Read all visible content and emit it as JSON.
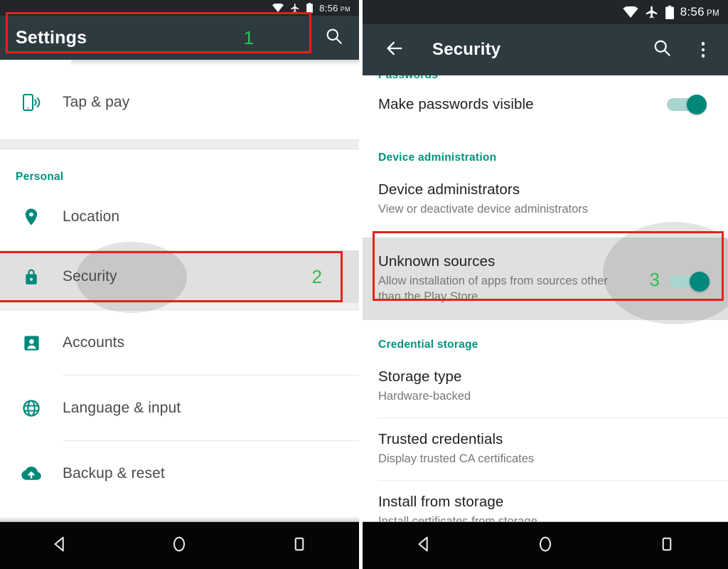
{
  "left_panel": {
    "statusbar": {
      "time": "8:56",
      "ampm": "PM",
      "icons": [
        "wifi-icon",
        "airplane-icon",
        "battery-icon"
      ]
    },
    "appbar": {
      "title": "Settings",
      "search_icon": "search-icon"
    },
    "scroll_hint": "top-shadow",
    "items": [
      {
        "label": "Tap & pay",
        "icon": "nfc-phone-icon",
        "marker": ""
      }
    ],
    "section": {
      "label": "Personal"
    },
    "personal_items": [
      {
        "label": "Location",
        "icon": "location-pin-icon",
        "marker": ""
      },
      {
        "label": "Security",
        "icon": "lock-icon",
        "marker": "2",
        "highlighted": true
      },
      {
        "label": "Accounts",
        "icon": "account-icon",
        "marker": ""
      },
      {
        "label": "Language & input",
        "icon": "globe-icon",
        "marker": ""
      },
      {
        "label": "Backup & reset",
        "icon": "cloud-upload-icon",
        "marker": ""
      }
    ],
    "annotations": [
      {
        "label": "1",
        "target": "appbar-title"
      },
      {
        "label": "2",
        "target": "security-row"
      }
    ],
    "navbar": {
      "back": "back-triangle-icon",
      "home": "home-circle-icon",
      "recents": "recents-square-icon"
    }
  },
  "right_panel": {
    "statusbar": {
      "time": "8:56",
      "ampm": "PM",
      "icons": [
        "wifi-icon",
        "airplane-icon",
        "battery-icon"
      ]
    },
    "appbar": {
      "title": "Security",
      "back_icon": "back-arrow-icon",
      "search_icon": "search-icon",
      "overflow_icon": "overflow-menu-icon"
    },
    "sections": [
      {
        "header": "Passwords",
        "rows": [
          {
            "title": "Make passwords visible",
            "subtitle": "",
            "toggle": true,
            "toggle_on": true,
            "marker": ""
          }
        ]
      },
      {
        "header": "Device administration",
        "rows": [
          {
            "title": "Device administrators",
            "subtitle": "View or deactivate device administrators",
            "toggle": false,
            "marker": ""
          },
          {
            "title": "Unknown sources",
            "subtitle": "Allow installation of apps from sources other than the Play Store",
            "toggle": true,
            "toggle_on": true,
            "marker": "3",
            "highlighted": true
          }
        ]
      },
      {
        "header": "Credential storage",
        "rows": [
          {
            "title": "Storage type",
            "subtitle": "Hardware-backed",
            "toggle": false,
            "marker": ""
          },
          {
            "title": "Trusted credentials",
            "subtitle": "Display trusted CA certificates",
            "toggle": false,
            "marker": ""
          },
          {
            "title": "Install from storage",
            "subtitle": "Install certificates from storage",
            "toggle": false,
            "marker": ""
          }
        ]
      }
    ],
    "annotations": [
      {
        "label": "3",
        "target": "unknown-sources-row"
      }
    ],
    "navbar": {
      "back": "back-triangle-icon",
      "home": "home-circle-icon",
      "recents": "recents-square-icon"
    }
  },
  "colors": {
    "appbar_bg": "#2d3b41",
    "statusbar_bg": "#20262a",
    "accent_teal": "#00937f",
    "icon_teal": "#00897a",
    "toggle_thumb": "#00897a",
    "toggle_track": "#a9d5ce",
    "annotation_red": "#e2231a",
    "marker_green": "#2fbf4f",
    "highlight_gray": "#e0e0e0"
  }
}
